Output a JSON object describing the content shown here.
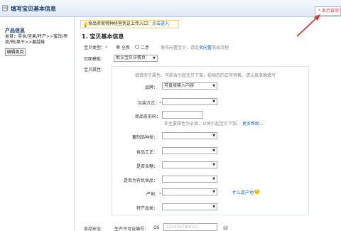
{
  "header": {
    "title": "填写宝贝基本信息",
    "required_note": "* 表示该项"
  },
  "sidebar": {
    "title": "产品信息",
    "category_path": "类目：零食/坚果/特产>>蜜饯/枣类/梅/果干>>蔓越莓",
    "edit_button": "编辑类目"
  },
  "notice": {
    "text": "食品卖家特种经营凭证上传入口：",
    "link": "点击进入"
  },
  "section": {
    "title": "1. 宝贝基本信息",
    "type_label": "宝贝类型：",
    "type_new": "全新",
    "type_used": "二手",
    "type_hint_pre": "发布闲置宝贝，请走",
    "type_hint_link": "卖闲置",
    "type_hint_post": "简易流程",
    "template_label": "页面模板：",
    "template_value": "默认宝贝详情页",
    "attr_label": "宝贝属性："
  },
  "attributes": {
    "hint": "填错宝贝属性，可能会引起宝贝下架，影响您的正常销售。请认真准确填写",
    "brand_label": "品牌：",
    "brand_placeholder": "可直接输入内容",
    "packing_label": "包装方式：",
    "barcode_label": "商品条形码：",
    "barcode_hint": "非主要属性为必填，以免引起宝贝下架。",
    "barcode_help": "更多帮助...",
    "preserve_label": "蓄制品种类：",
    "craft_label": "食品工艺：",
    "sugar_label": "是否含糖：",
    "organic_label": "是否为有机食品：",
    "origin_label": "产地：",
    "origin_help": "什么是产地",
    "specialty_label": "特产品类："
  },
  "food_safety": {
    "label": "食品安全：",
    "license_label": "生产许可证编号：",
    "license_prefix": "QS",
    "license_placeholder": "123456789012"
  },
  "colors": {
    "header_title": "#1a3d6d",
    "required_star": "#e4393c",
    "link": "#1565c0",
    "annotation_arrow": "#d9342b"
  }
}
